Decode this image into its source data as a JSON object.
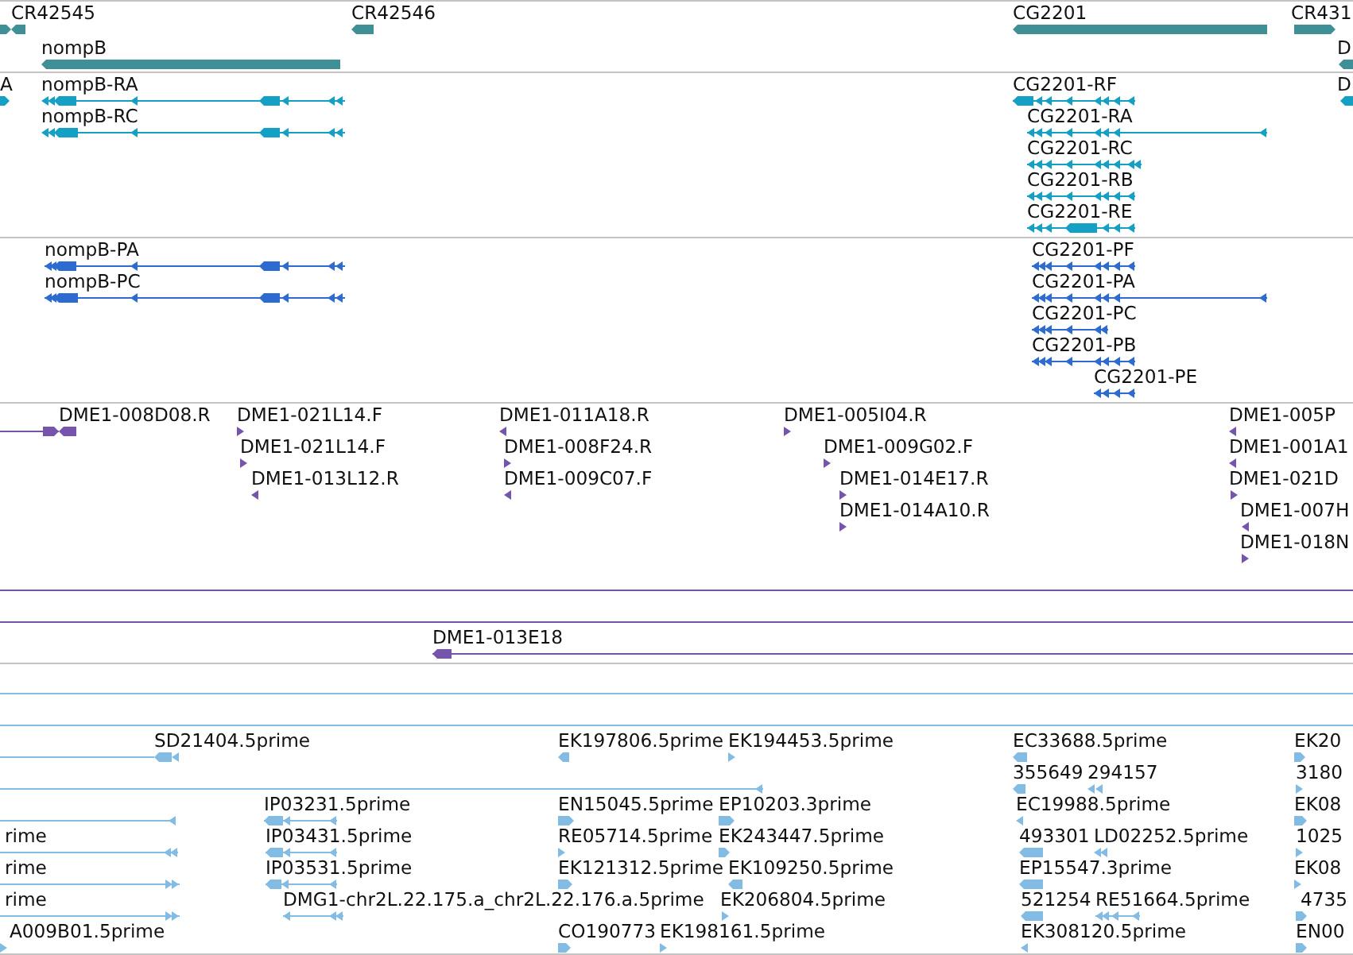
{
  "tracks": [
    {
      "kind": "gene",
      "rows": [
        {
          "features": [
            {
              "kind": "feature",
              "reverse": false
            },
            {
              "kind": "feature",
              "label": "CR42545",
              "reverse": true
            },
            {
              "kind": "feature",
              "label": "CR42546",
              "reverse": true
            },
            {
              "kind": "feature",
              "label": "CG2201",
              "reverse": true
            },
            {
              "kind": "feature",
              "label": "CR431",
              "reverse": false
            }
          ]
        },
        {
          "features": [
            {
              "kind": "feature",
              "label": "nompB",
              "reverse": true
            },
            {
              "kind": "feature",
              "label": "D",
              "reverse": true
            }
          ]
        }
      ]
    },
    {
      "kind": "transcript",
      "rows": [
        {
          "features": [
            {
              "kind": "feature",
              "label": "A",
              "reverse": false
            },
            {
              "kind": "feature",
              "label": "nompB-RA",
              "reverse": true
            },
            {
              "kind": "feature",
              "label": "CG2201-RF",
              "reverse": true
            },
            {
              "kind": "feature",
              "label": "D",
              "reverse": true
            }
          ]
        },
        {
          "features": [
            {
              "kind": "feature",
              "label": "nompB-RC",
              "reverse": true
            },
            {
              "kind": "feature",
              "label": "CG2201-RA",
              "reverse": true
            }
          ]
        },
        {
          "features": [
            {
              "kind": "feature",
              "label": "CG2201-RC",
              "reverse": true
            }
          ]
        },
        {
          "features": [
            {
              "kind": "feature",
              "label": "CG2201-RB",
              "reverse": true
            }
          ]
        },
        {
          "features": [
            {
              "kind": "feature",
              "label": "CG2201-RE",
              "reverse": true
            }
          ]
        }
      ]
    },
    {
      "kind": "protein",
      "rows": [
        {
          "features": [
            {
              "kind": "feature",
              "label": "nompB-PA",
              "reverse": true
            },
            {
              "kind": "feature",
              "label": "CG2201-PF",
              "reverse": true
            }
          ]
        },
        {
          "features": [
            {
              "kind": "feature",
              "label": "nompB-PC",
              "reverse": true
            },
            {
              "kind": "feature",
              "label": "CG2201-PA",
              "reverse": true
            }
          ]
        },
        {
          "features": [
            {
              "kind": "feature",
              "label": "CG2201-PC",
              "reverse": true
            }
          ]
        },
        {
          "features": [
            {
              "kind": "feature",
              "label": "CG2201-PB",
              "reverse": true
            }
          ]
        },
        {
          "features": [
            {
              "kind": "feature",
              "label": "CG2201-PE",
              "reverse": true
            }
          ]
        }
      ]
    },
    {
      "kind": "clone",
      "rows": [
        {
          "features": [
            {
              "kind": "feature",
              "reverse": false
            },
            {
              "kind": "feature",
              "label": "DME1-008D08.R",
              "reverse": true
            },
            {
              "kind": "feature",
              "label": "DME1-021L14.F",
              "reverse": false
            },
            {
              "kind": "feature",
              "label": "DME1-011A18.R",
              "reverse": true
            },
            {
              "kind": "feature",
              "label": "DME1-005I04.R",
              "reverse": false
            },
            {
              "kind": "feature",
              "label": "DME1-005P",
              "reverse": true
            }
          ]
        },
        {
          "features": [
            {
              "kind": "feature",
              "label": "DME1-021L14.F",
              "reverse": false
            },
            {
              "kind": "feature",
              "label": "DME1-008F24.R",
              "reverse": false
            },
            {
              "kind": "feature",
              "label": "DME1-009G02.F",
              "reverse": false
            },
            {
              "kind": "feature",
              "label": "DME1-001A1",
              "reverse": true
            }
          ]
        },
        {
          "features": [
            {
              "kind": "feature",
              "label": "DME1-013L12.R",
              "reverse": true
            },
            {
              "kind": "feature",
              "label": "DME1-009C07.F",
              "reverse": true
            },
            {
              "kind": "feature",
              "label": "DME1-014E17.R",
              "reverse": false
            },
            {
              "kind": "feature",
              "label": "DME1-021D",
              "reverse": false
            }
          ]
        },
        {
          "features": [
            {
              "kind": "feature",
              "label": "DME1-014A10.R",
              "reverse": false
            },
            {
              "kind": "feature",
              "label": "DME1-007H",
              "reverse": true
            }
          ]
        },
        {
          "features": [
            {
              "kind": "feature",
              "label": "DME1-018N",
              "reverse": false
            }
          ]
        },
        {
          "features": [
            {
              "kind": "span"
            }
          ]
        },
        {
          "features": [
            {
              "kind": "span"
            }
          ]
        },
        {
          "features": [
            {
              "kind": "feature",
              "label": "DME1-013E18",
              "reverse": true
            }
          ]
        }
      ]
    },
    {
      "kind": "est",
      "rows": [
        {
          "features": [
            {
              "kind": "span"
            }
          ]
        },
        {
          "features": [
            {
              "kind": "span"
            }
          ]
        },
        {
          "features": [
            {
              "kind": "span"
            },
            {
              "kind": "feature",
              "label": "SD21404.5prime",
              "reverse": true
            },
            {
              "kind": "feature",
              "label": "EK197806.5prime",
              "reverse": true
            },
            {
              "kind": "feature",
              "label": "EK194453.5prime",
              "reverse": false
            },
            {
              "kind": "feature",
              "label": "EC33688.5prime",
              "reverse": true
            },
            {
              "kind": "feature",
              "label": "EK20",
              "reverse": false
            }
          ]
        },
        {
          "features": [
            {
              "kind": "feature",
              "reverse": true
            },
            {
              "kind": "feature",
              "label": "355649",
              "reverse": true
            },
            {
              "kind": "feature",
              "label": "294157",
              "reverse": true
            },
            {
              "kind": "feature",
              "label": "3180",
              "reverse": false
            }
          ]
        },
        {
          "features": [
            {
              "kind": "feature",
              "reverse": true
            },
            {
              "kind": "feature",
              "label": "IP03231.5prime",
              "reverse": true
            },
            {
              "kind": "feature",
              "label": "EN15045.5prime",
              "reverse": false
            },
            {
              "kind": "feature",
              "label": "EP10203.3prime",
              "reverse": false
            },
            {
              "kind": "feature",
              "label": "EC19988.5prime",
              "reverse": true
            },
            {
              "kind": "feature",
              "label": "EK08",
              "reverse": false
            }
          ]
        },
        {
          "features": [
            {
              "kind": "feature",
              "label": "rime",
              "reverse": true
            },
            {
              "kind": "feature",
              "label": "IP03431.5prime",
              "reverse": true
            },
            {
              "kind": "feature",
              "label": "RE05714.5prime",
              "reverse": false
            },
            {
              "kind": "feature",
              "label": "EK243447.5prime",
              "reverse": false
            },
            {
              "kind": "feature",
              "label": "493301",
              "reverse": true
            },
            {
              "kind": "feature",
              "label": "LD02252.5prime",
              "reverse": true
            },
            {
              "kind": "feature",
              "label": "1025",
              "reverse": false
            }
          ]
        },
        {
          "features": [
            {
              "kind": "feature",
              "label": "rime",
              "reverse": false
            },
            {
              "kind": "feature",
              "label": "IP03531.5prime",
              "reverse": true
            },
            {
              "kind": "feature",
              "label": "EK121312.5prime",
              "reverse": false
            },
            {
              "kind": "feature",
              "label": "EK109250.5prime",
              "reverse": true
            },
            {
              "kind": "feature",
              "label": "EP15547.3prime",
              "reverse": true
            },
            {
              "kind": "feature",
              "label": "EK08",
              "reverse": false
            }
          ]
        },
        {
          "features": [
            {
              "kind": "feature",
              "label": "rime",
              "reverse": false
            },
            {
              "kind": "feature",
              "label": "DMG1-chr2L.22.175.a_chr2L.22.176.a.5prime",
              "reverse": true
            },
            {
              "kind": "feature",
              "label": "EK206804.5prime",
              "reverse": false
            },
            {
              "kind": "feature",
              "label": "521254",
              "reverse": true
            },
            {
              "kind": "feature",
              "label": "RE51664.5prime",
              "reverse": true
            },
            {
              "kind": "feature",
              "label": "4735",
              "reverse": false
            }
          ]
        },
        {
          "features": [
            {
              "kind": "feature",
              "label": "A009B01.5prime",
              "reverse": false
            },
            {
              "kind": "feature",
              "label": "CO190773",
              "reverse": false
            },
            {
              "kind": "feature",
              "label": "EK198161.5prime",
              "reverse": false
            },
            {
              "kind": "feature",
              "label": "EK308120.5prime",
              "reverse": true
            },
            {
              "kind": "feature",
              "label": "EN00",
              "reverse": false
            }
          ]
        }
      ]
    }
  ]
}
